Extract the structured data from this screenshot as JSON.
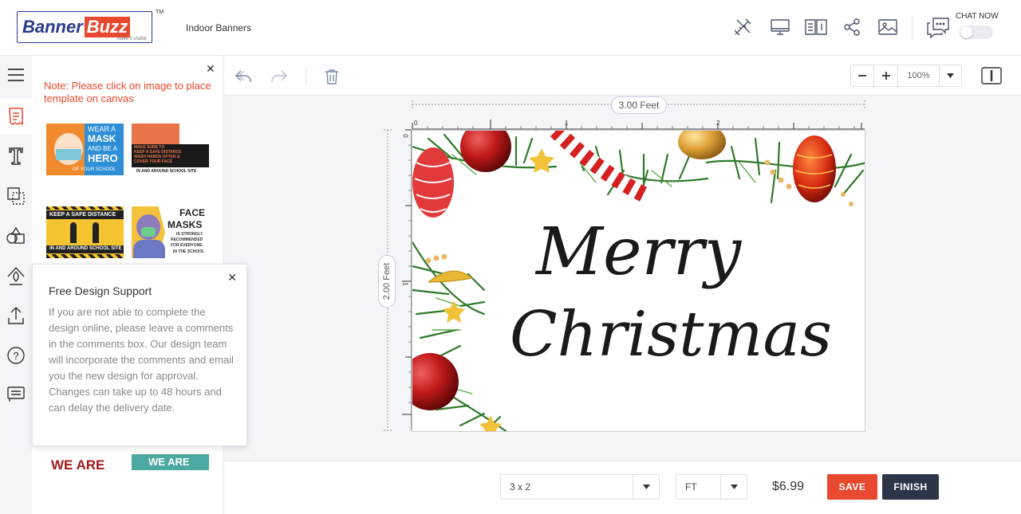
{
  "header": {
    "logo_part1": "Banner",
    "logo_part2": "Buzz",
    "logo_tagline": "make it visible",
    "logo_tm": "TM",
    "product_name": "Indoor Banners",
    "chat_label": "CHAT NOW",
    "icons": [
      "design-tools-icon",
      "preview-icon",
      "guide-icon",
      "share-icon",
      "image-icon",
      "chat-icon"
    ]
  },
  "rail": {
    "items": [
      "menu-icon",
      "templates-icon",
      "text-icon",
      "layers-icon",
      "shapes-icon",
      "clipart-icon",
      "upload-icon",
      "help-icon",
      "comments-icon"
    ]
  },
  "templates_panel": {
    "note": "Note: Please click on image to place template on canvas",
    "thumbs": [
      {
        "lines": [
          "WEAR A",
          "MASK",
          "AND BE A",
          "HERO",
          "OF YOUR SCHOOL"
        ]
      },
      {
        "lines": [
          "MAKE SURE TO",
          "KEEP A SAFE DISTANCE",
          "WASH HANDS OFTEN &",
          "COVER YOUR FACE",
          "IN AND AROUND SCHOOL SITE"
        ]
      },
      {
        "lines": [
          "KEEP A SAFE DISTANCE",
          "IN AND AROUND SCHOOL SITE"
        ]
      },
      {
        "lines": [
          "FACE",
          "MASKS",
          "IS STRONGLY",
          "RECOMMENDED",
          "FOR EVERYONE",
          "IN THE SCHOOL"
        ]
      },
      {
        "lines": [
          "WE ARE"
        ]
      },
      {
        "lines": [
          "WE ARE"
        ]
      }
    ]
  },
  "support_popup": {
    "title": "Free Design Support",
    "body": "If you are not able to complete the design online, please leave a comments in the comments box. Our design team will incorporate the comments and email you the new design for approval. Changes can take up to 48 hours and can delay the delivery date."
  },
  "toolbar": {
    "zoom_value": "100%"
  },
  "canvas": {
    "width_label": "3.00 Feet",
    "height_label": "2.00 Feet",
    "h_ruler": [
      "0",
      "1",
      "2"
    ],
    "v_ruler": [
      "0",
      "1"
    ],
    "greeting_line1": "Merry",
    "greeting_line2": "Christmas"
  },
  "bottom": {
    "size_value": "3 x 2",
    "unit_value": "FT",
    "price": "$6.99",
    "save_label": "SAVE",
    "finish_label": "FINISH"
  },
  "colors": {
    "accent": "#e8482d",
    "dark_button": "#2d3648",
    "brand_blue": "#2a3a8c"
  }
}
